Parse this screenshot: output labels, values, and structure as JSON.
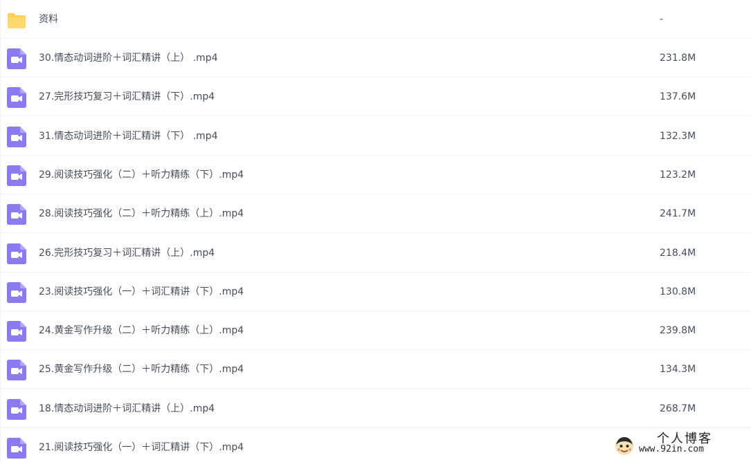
{
  "files": [
    {
      "type": "folder",
      "name": "资料",
      "size": "-"
    },
    {
      "type": "video",
      "name": "30.情态动词进阶＋词汇精讲（上） .mp4",
      "size": "231.8M"
    },
    {
      "type": "video",
      "name": "27.完形技巧复习＋词汇精讲（下）.mp4",
      "size": "137.6M"
    },
    {
      "type": "video",
      "name": "31.情态动词进阶＋词汇精讲（下） .mp4",
      "size": "132.3M"
    },
    {
      "type": "video",
      "name": "29.阅读技巧强化（二）＋听力精练（下）.mp4",
      "size": "123.2M"
    },
    {
      "type": "video",
      "name": "28.阅读技巧强化（二）＋听力精练（上）.mp4",
      "size": "241.7M"
    },
    {
      "type": "video",
      "name": "26.完形技巧复习＋词汇精讲（上）.mp4",
      "size": "218.4M"
    },
    {
      "type": "video",
      "name": "23.阅读技巧强化（一）＋词汇精讲（下）.mp4",
      "size": "130.8M"
    },
    {
      "type": "video",
      "name": "24.黄金写作升级（二）＋听力精练（上）.mp4",
      "size": "239.8M"
    },
    {
      "type": "video",
      "name": "25.黄金写作升级（二）＋听力精练（下）.mp4",
      "size": "134.3M"
    },
    {
      "type": "video",
      "name": "18.情态动词进阶＋词汇精讲（上）.mp4",
      "size": "268.7M"
    },
    {
      "type": "video",
      "name": "21.阅读技巧强化（一）＋词汇精讲（下）.mp4",
      "size": ""
    }
  ],
  "watermark": {
    "title": "个人博客",
    "url": "www.92in.com"
  },
  "colors": {
    "folder": "#ffd25e",
    "video": "#8a7cf0",
    "text": "#454d5a",
    "divider": "#eef0f4"
  },
  "icons": {
    "folder": "folder-icon",
    "video": "video-file-icon"
  }
}
